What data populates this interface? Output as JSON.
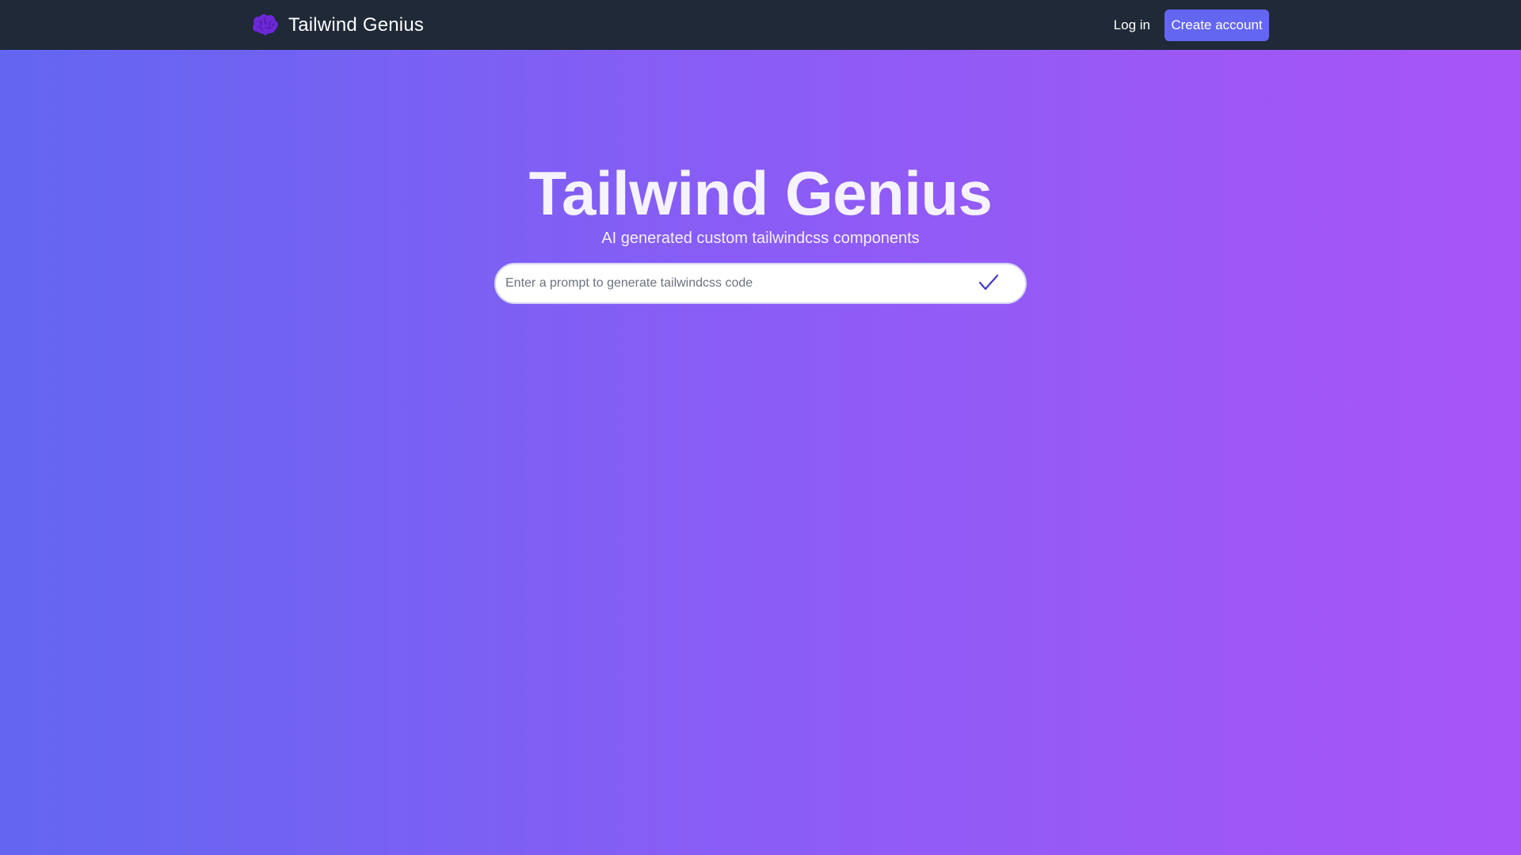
{
  "navbar": {
    "brand": {
      "name": "Tailwind Genius",
      "icon": "brain-icon",
      "icon_color": "#6d28d9"
    },
    "login_label": "Log in",
    "create_account_label": "Create account",
    "background_color": "#1f2937",
    "button_color": "#6366f1"
  },
  "hero": {
    "title": "Tailwind Genius",
    "subtitle": "AI generated custom tailwindcss components"
  },
  "prompt": {
    "value": "",
    "placeholder": "Enter a prompt to generate tailwindcss code",
    "submit_icon": "checkmark-icon",
    "submit_icon_color": "#4338ca"
  },
  "theme": {
    "gradient_start": "#6366f1",
    "gradient_end": "#a855f7"
  }
}
